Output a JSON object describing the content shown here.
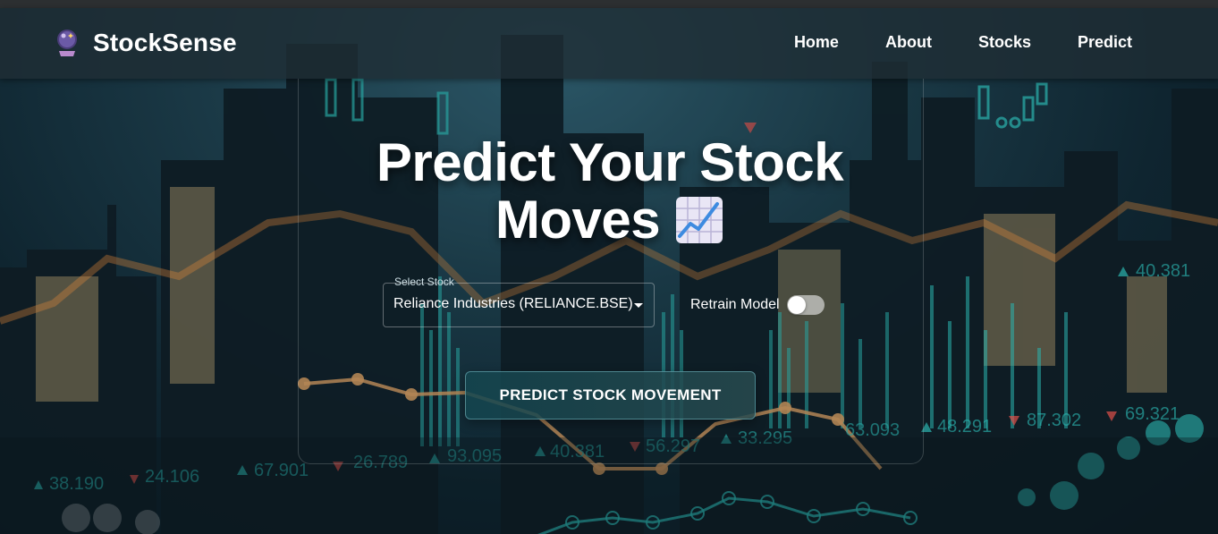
{
  "navbar": {
    "brand": "StockSense",
    "brand_icon": "crystal-ball-icon",
    "links": [
      {
        "label": "Home"
      },
      {
        "label": "About"
      },
      {
        "label": "Stocks"
      },
      {
        "label": "Predict"
      }
    ]
  },
  "hero": {
    "title_line1": "Predict Your Stock",
    "title_line2": "Moves",
    "title_icon": "chart-increasing-icon"
  },
  "form": {
    "select_label": "Select Stock",
    "select_value": "Reliance Industries (RELIANCE.BSE)",
    "retrain_label": "Retrain Model",
    "retrain_on": false,
    "submit_label": "PREDICT STOCK MOVEMENT"
  },
  "background_tickers": [
    "38.190",
    "24.106",
    "67.901",
    "26.789",
    "93.095",
    "40.381",
    "56.297",
    "33.295",
    "63.093",
    "48.291",
    "87.302",
    "69.321",
    "40.381"
  ],
  "colors": {
    "accent": "#2bb3ae",
    "down": "#e0504a",
    "orange_line": "#e58a3a"
  }
}
